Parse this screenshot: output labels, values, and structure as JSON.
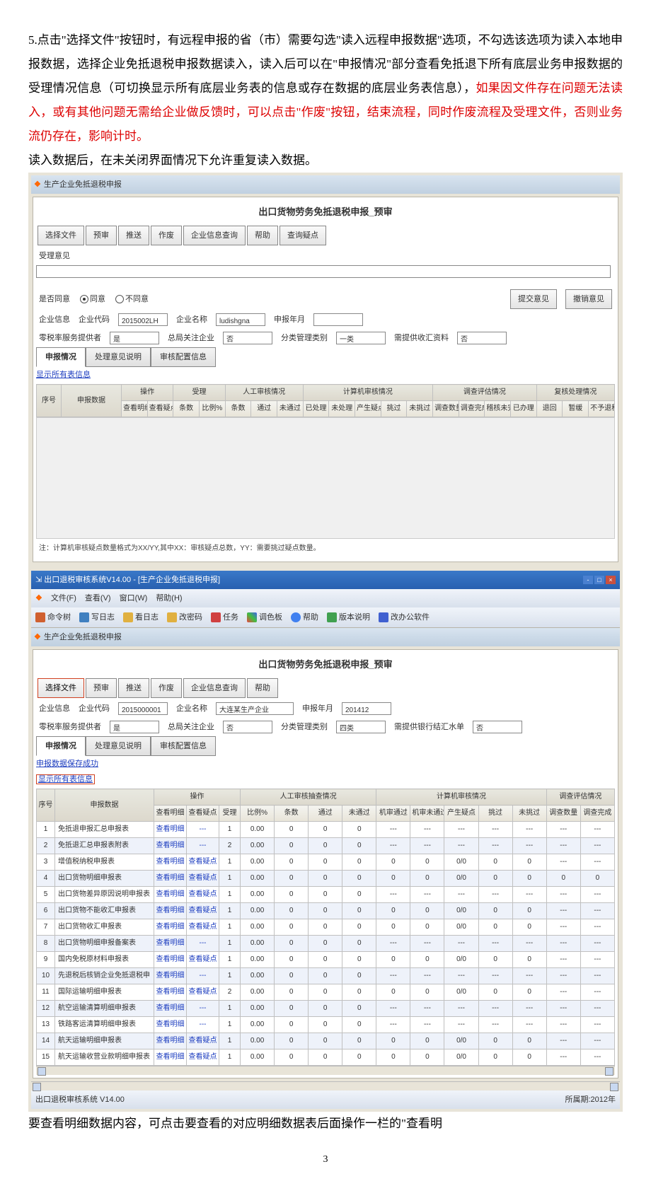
{
  "body": {
    "p1_a": "5.点击\"选择文件\"按钮时，有远程申报的省（市）需要勾选\"读入远程申报数据\"选项，不勾选该选项为读入本地申报数据，选择企业免抵退税申报数据读入，读入后可以在\"申报情况\"部分查看免抵退下所有底层业务申报数据的受理情况信息（可切换显示所有底层业务表的信息或存在数据的底层业务表信息），",
    "p1_b": "如果因文件存在问题无法读入，或有其他问题无需给企业做反馈时，可以点击\"作废\"按钮，结束流程，同时作废流程及受理文件，否则业务流仍存在，影响计时。",
    "p2": "读入数据后，在未关闭界面情况下允许重复读入数据。",
    "p3": "要查看明细数据内容，可点击要查看的对应明细数据表后面操作一栏的\"查看明",
    "pagenum": "3"
  },
  "shot1": {
    "win_title": "生产企业免抵退税申报",
    "page_title": "出口货物劳务免抵退税申报_预审",
    "buttons": [
      "选择文件",
      "预审",
      "推送",
      "作废",
      "企业信息查询",
      "帮助",
      "查询疑点"
    ],
    "feedback_label": "受理意见",
    "agree_label": "是否同意",
    "agree_yes": "同意",
    "agree_no": "不同意",
    "submit_opinion": "提交意见",
    "revoke_opinion": "撤销意见",
    "company_label": "企业信息",
    "code_label": "企业代码",
    "code_value": "2015002LH",
    "name_label": "企业名称",
    "name_value": "ludishgna",
    "period_label": "申报年月",
    "zero_label": "零税率服务提供者",
    "zero_value": "是",
    "zongguan_label": "总局关注企业",
    "zongguan_value": "否",
    "fenlei_label": "分类管理类别",
    "fenlei_value": "一类",
    "xutigong_label": "需提供收汇资料",
    "xutigong_value": "否",
    "tabs": [
      "申报情况",
      "处理意见说明",
      "审核配置信息"
    ],
    "show_all": "显示所有表信息",
    "head_main": [
      "序号",
      "申报数据"
    ],
    "group_op": "操作",
    "group_shouli": "受理",
    "group_rengong": "人工审核情况",
    "group_jisuan": "计算机审核情况",
    "group_diaocha": "调查评估情况",
    "group_fuhe": "复核处理情况",
    "sub_op": [
      "查看明细",
      "查看疑点",
      "条数",
      "比例%",
      "条数",
      "通过",
      "未通过",
      "已处理",
      "未处理",
      "产生疑点",
      "挑过",
      "未挑过",
      "调查数量",
      "调查完成",
      "稽核未完成",
      "已办理",
      "退回",
      "暂缓",
      "不予退税"
    ],
    "note": "注：计算机审核疑点数量格式为XX/YY,其中XX：审核疑点总数，YY：需要挑过疑点数量。"
  },
  "shot2": {
    "app_title": "出口退税审核系统V14.00  -  [生产企业免抵退税申报]",
    "menus": [
      "文件(F)",
      "查看(V)",
      "窗口(W)",
      "帮助(H)"
    ],
    "toolbar": [
      "命令树",
      "写日志",
      "看日志",
      "改密码",
      "任务",
      "调色板",
      "帮助",
      "版本说明",
      "改办公软件"
    ],
    "tab_title": "生产企业免抵退税申报",
    "page_title": "出口货物劳务免抵退税申报_预审",
    "buttons": [
      "选择文件",
      "预审",
      "推送",
      "作废",
      "企业信息查询",
      "帮助"
    ],
    "company_label": "企业信息",
    "code_label": "企业代码",
    "code_value": "2015000001",
    "name_label": "企业名称",
    "name_value": "大连某生产企业",
    "period_label": "申报年月",
    "period_value": "201412",
    "zero_label": "零税率服务提供者",
    "zero_value": "是",
    "zongguan_label": "总局关注企业",
    "zongguan_value": "否",
    "fenlei_label": "分类管理类别",
    "fenlei_value": "四类",
    "xutigong_label": "需提供银行结汇水单",
    "xutigong_value": "否",
    "tabs": [
      "申报情况",
      "处理意见说明",
      "审核配置信息"
    ],
    "load_ok": "申报数据保存成功",
    "show_all": "显示所有表信息",
    "head_main": [
      "序号",
      "申报数据"
    ],
    "group_op": "操作",
    "group_rengong": "人工审核抽查情况",
    "group_jisuan": "计算机审核情况",
    "group_diaocha": "调查评估情况",
    "sub_op": [
      "查看明细",
      "查看疑点",
      "受理",
      "比例%",
      "条数",
      "通过",
      "未通过",
      "机审通过",
      "机审未通过",
      "产生疑点",
      "挑过",
      "未挑过",
      "调查数量",
      "调查完成"
    ],
    "rows": [
      {
        "idx": 1,
        "name": "免抵退申报汇总申报表",
        "det": "查看明细",
        "yd": "---",
        "sl": 1,
        "bl": "0.00",
        "ts": 0,
        "tg": 0,
        "wtg": 0,
        "jstg": "---",
        "jswtg": "---",
        "cs": "---",
        "tgx": "---",
        "wtgx": "---",
        "dcsl": "---",
        "dcwc": "---"
      },
      {
        "idx": 2,
        "name": "免抵退汇总申报表附表",
        "det": "查看明细",
        "yd": "---",
        "sl": 2,
        "bl": "0.00",
        "ts": 0,
        "tg": 0,
        "wtg": 0,
        "jstg": "---",
        "jswtg": "---",
        "cs": "---",
        "tgx": "---",
        "wtgx": "---",
        "dcsl": "---",
        "dcwc": "---"
      },
      {
        "idx": 3,
        "name": "增值税纳税申报表",
        "det": "查看明细",
        "yd": "查看疑点",
        "sl": 1,
        "bl": "0.00",
        "ts": 0,
        "tg": 0,
        "wtg": 0,
        "jstg": 0,
        "jswtg": 0,
        "cs": "0/0",
        "tgx": 0,
        "wtgx": 0,
        "dcsl": "---",
        "dcwc": "---"
      },
      {
        "idx": 4,
        "name": "出口货物明细申报表",
        "det": "查看明细",
        "yd": "查看疑点",
        "sl": 1,
        "bl": "0.00",
        "ts": 0,
        "tg": 0,
        "wtg": 0,
        "jstg": 0,
        "jswtg": 0,
        "cs": "0/0",
        "tgx": 0,
        "wtgx": 0,
        "dcsl": 0,
        "dcwc": 0
      },
      {
        "idx": 5,
        "name": "出口货物差异原因说明申报表",
        "det": "查看明细",
        "yd": "查看疑点",
        "sl": 1,
        "bl": "0.00",
        "ts": 0,
        "tg": 0,
        "wtg": 0,
        "jstg": "---",
        "jswtg": "---",
        "cs": "---",
        "tgx": "---",
        "wtgx": "---",
        "dcsl": "---",
        "dcwc": "---"
      },
      {
        "idx": 6,
        "name": "出口货物不能收汇申报表",
        "det": "查看明细",
        "yd": "查看疑点",
        "sl": 1,
        "bl": "0.00",
        "ts": 0,
        "tg": 0,
        "wtg": 0,
        "jstg": 0,
        "jswtg": 0,
        "cs": "0/0",
        "tgx": 0,
        "wtgx": 0,
        "dcsl": "---",
        "dcwc": "---"
      },
      {
        "idx": 7,
        "name": "出口货物收汇申报表",
        "det": "查看明细",
        "yd": "查看疑点",
        "sl": 1,
        "bl": "0.00",
        "ts": 0,
        "tg": 0,
        "wtg": 0,
        "jstg": 0,
        "jswtg": 0,
        "cs": "0/0",
        "tgx": 0,
        "wtgx": 0,
        "dcsl": "---",
        "dcwc": "---"
      },
      {
        "idx": 8,
        "name": "出口货物明细申报备案表",
        "det": "查看明细",
        "yd": "---",
        "sl": 1,
        "bl": "0.00",
        "ts": 0,
        "tg": 0,
        "wtg": 0,
        "jstg": "---",
        "jswtg": "---",
        "cs": "---",
        "tgx": "---",
        "wtgx": "---",
        "dcsl": "---",
        "dcwc": "---"
      },
      {
        "idx": 9,
        "name": "国内免税原材料申报表",
        "det": "查看明细",
        "yd": "查看疑点",
        "sl": 1,
        "bl": "0.00",
        "ts": 0,
        "tg": 0,
        "wtg": 0,
        "jstg": 0,
        "jswtg": 0,
        "cs": "0/0",
        "tgx": 0,
        "wtgx": 0,
        "dcsl": "---",
        "dcwc": "---"
      },
      {
        "idx": 10,
        "name": "先退税后核销企业免抵退税申",
        "det": "查看明细",
        "yd": "---",
        "sl": 1,
        "bl": "0.00",
        "ts": 0,
        "tg": 0,
        "wtg": 0,
        "jstg": "---",
        "jswtg": "---",
        "cs": "---",
        "tgx": "---",
        "wtgx": "---",
        "dcsl": "---",
        "dcwc": "---"
      },
      {
        "idx": 11,
        "name": "国际运输明细申报表",
        "det": "查看明细",
        "yd": "查看疑点",
        "sl": 2,
        "bl": "0.00",
        "ts": 0,
        "tg": 0,
        "wtg": 0,
        "jstg": 0,
        "jswtg": 0,
        "cs": "0/0",
        "tgx": 0,
        "wtgx": 0,
        "dcsl": "---",
        "dcwc": "---"
      },
      {
        "idx": 12,
        "name": "航空运输清算明细申报表",
        "det": "查看明细",
        "yd": "---",
        "sl": 1,
        "bl": "0.00",
        "ts": 0,
        "tg": 0,
        "wtg": 0,
        "jstg": "---",
        "jswtg": "---",
        "cs": "---",
        "tgx": "---",
        "wtgx": "---",
        "dcsl": "---",
        "dcwc": "---"
      },
      {
        "idx": 13,
        "name": "铁路客运清算明细申报表",
        "det": "查看明细",
        "yd": "---",
        "sl": 1,
        "bl": "0.00",
        "ts": 0,
        "tg": 0,
        "wtg": 0,
        "jstg": "---",
        "jswtg": "---",
        "cs": "---",
        "tgx": "---",
        "wtgx": "---",
        "dcsl": "---",
        "dcwc": "---"
      },
      {
        "idx": 14,
        "name": "航天运输明细申报表",
        "det": "查看明细",
        "yd": "查看疑点",
        "sl": 1,
        "bl": "0.00",
        "ts": 0,
        "tg": 0,
        "wtg": 0,
        "jstg": 0,
        "jswtg": 0,
        "cs": "0/0",
        "tgx": 0,
        "wtgx": 0,
        "dcsl": "---",
        "dcwc": "---"
      },
      {
        "idx": 15,
        "name": "航天运输收营业款明细申报表",
        "det": "查看明细",
        "yd": "查看疑点",
        "sl": 1,
        "bl": "0.00",
        "ts": 0,
        "tg": 0,
        "wtg": 0,
        "jstg": 0,
        "jswtg": 0,
        "cs": "0/0",
        "tgx": 0,
        "wtgx": 0,
        "dcsl": "---",
        "dcwc": "---"
      }
    ],
    "status_left": "出口退税审核系统 V14.00",
    "status_right": "所属期:2012年"
  }
}
